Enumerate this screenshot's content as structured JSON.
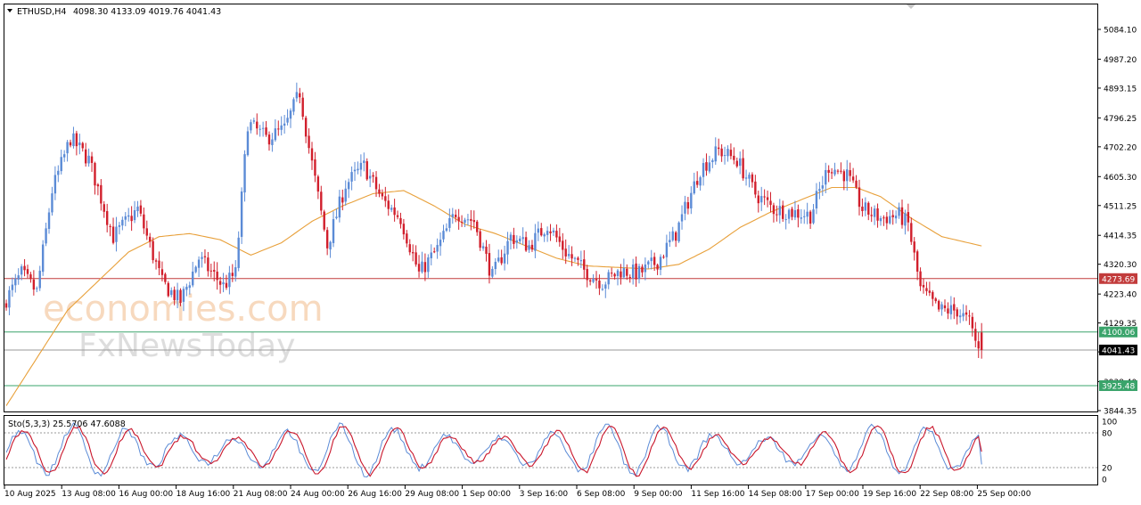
{
  "header": {
    "symbol": "ETHUSD,H4",
    "ohlc": "4098.30 4133.09 4019.76 4041.43"
  },
  "watermark": {
    "line1": "economies.com",
    "line2": "FxNewsToday"
  },
  "colors": {
    "bull": "#5b8bd6",
    "bear": "#d11f2c",
    "ma": "#e8a03a",
    "resistance_line": "#c23b3b",
    "support_line": "#3aa46b",
    "current_line": "#9a9a9a",
    "stoch_main": "#c9162b",
    "stoch_signal": "#5b8bd6"
  },
  "chart_data": {
    "type": "candlestick",
    "title": "ETHUSD,H4",
    "ylim": [
      3844.35,
      5084.1
    ],
    "y_ticks": [
      "5084.10",
      "4987.20",
      "4893.15",
      "4796.25",
      "4702.20",
      "4605.30",
      "4511.25",
      "4414.35",
      "4320.30",
      "4223.40",
      "4129.35",
      "4035.30",
      "3938.40",
      "3844.35"
    ],
    "x_ticks": [
      "10 Aug 2025",
      "13 Aug 08:00",
      "16 Aug 00:00",
      "18 Aug 16:00",
      "21 Aug 08:00",
      "24 Aug 00:00",
      "26 Aug 16:00",
      "29 Aug 08:00",
      "1 Sep 00:00",
      "3 Sep 16:00",
      "6 Sep 08:00",
      "9 Sep 00:00",
      "11 Sep 16:00",
      "14 Sep 08:00",
      "17 Sep 00:00",
      "19 Sep 16:00",
      "22 Sep 08:00",
      "25 Sep 00:00"
    ],
    "levels": [
      {
        "label": "4273.69",
        "value": 4273.69,
        "kind": "resistance"
      },
      {
        "label": "4100.06",
        "value": 4100.06,
        "kind": "support"
      },
      {
        "label": "4041.43",
        "value": 4041.43,
        "kind": "current"
      },
      {
        "label": "3925.48",
        "value": 3925.48,
        "kind": "support"
      }
    ],
    "anchors": [
      [
        0,
        4190
      ],
      [
        6,
        4290
      ],
      [
        11,
        4230
      ],
      [
        16,
        4560
      ],
      [
        22,
        4730
      ],
      [
        28,
        4660
      ],
      [
        36,
        4410
      ],
      [
        44,
        4500
      ],
      [
        52,
        4260
      ],
      [
        58,
        4200
      ],
      [
        64,
        4340
      ],
      [
        72,
        4250
      ],
      [
        76,
        4290
      ],
      [
        80,
        4780
      ],
      [
        86,
        4730
      ],
      [
        92,
        4760
      ],
      [
        97,
        4880
      ],
      [
        100,
        4700
      ],
      [
        106,
        4380
      ],
      [
        112,
        4580
      ],
      [
        118,
        4640
      ],
      [
        124,
        4530
      ],
      [
        130,
        4470
      ],
      [
        136,
        4290
      ],
      [
        142,
        4370
      ],
      [
        148,
        4490
      ],
      [
        154,
        4460
      ],
      [
        160,
        4280
      ],
      [
        166,
        4410
      ],
      [
        172,
        4380
      ],
      [
        178,
        4450
      ],
      [
        184,
        4360
      ],
      [
        190,
        4300
      ],
      [
        196,
        4260
      ],
      [
        202,
        4300
      ],
      [
        208,
        4290
      ],
      [
        214,
        4330
      ],
      [
        220,
        4420
      ],
      [
        228,
        4630
      ],
      [
        234,
        4690
      ],
      [
        240,
        4660
      ],
      [
        246,
        4550
      ],
      [
        252,
        4500
      ],
      [
        258,
        4490
      ],
      [
        264,
        4480
      ],
      [
        270,
        4640
      ],
      [
        276,
        4610
      ],
      [
        281,
        4500
      ],
      [
        287,
        4470
      ],
      [
        293,
        4480
      ],
      [
        296,
        4450
      ],
      [
        300,
        4240
      ],
      [
        306,
        4170
      ],
      [
        312,
        4170
      ],
      [
        316,
        4130
      ],
      [
        319,
        4041
      ]
    ],
    "ma": [
      [
        0,
        3860
      ],
      [
        20,
        4170
      ],
      [
        40,
        4360
      ],
      [
        50,
        4410
      ],
      [
        60,
        4420
      ],
      [
        70,
        4400
      ],
      [
        80,
        4350
      ],
      [
        90,
        4390
      ],
      [
        100,
        4460
      ],
      [
        110,
        4510
      ],
      [
        120,
        4550
      ],
      [
        130,
        4560
      ],
      [
        140,
        4510
      ],
      [
        150,
        4450
      ],
      [
        160,
        4420
      ],
      [
        170,
        4380
      ],
      [
        180,
        4340
      ],
      [
        190,
        4315
      ],
      [
        200,
        4310
      ],
      [
        210,
        4305
      ],
      [
        220,
        4320
      ],
      [
        230,
        4370
      ],
      [
        240,
        4440
      ],
      [
        250,
        4490
      ],
      [
        260,
        4530
      ],
      [
        270,
        4570
      ],
      [
        278,
        4570
      ],
      [
        286,
        4540
      ],
      [
        296,
        4470
      ],
      [
        306,
        4410
      ],
      [
        319,
        4380
      ]
    ],
    "stochastic": {
      "label": "Sto(5,3,3) 25.5706 47.6088",
      "main": 25.5706,
      "signal": 47.6088,
      "levels": [
        "100",
        "80",
        "20",
        "0"
      ]
    }
  }
}
